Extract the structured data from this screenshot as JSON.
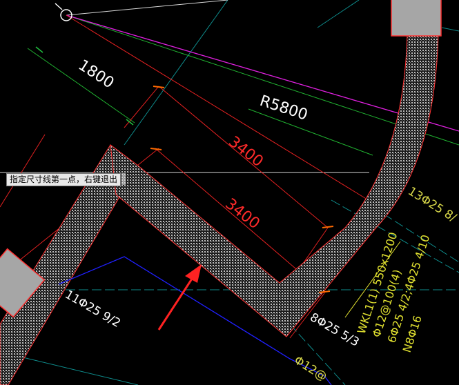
{
  "prompt": {
    "text": "指定尺寸线第一点，右键退出"
  },
  "drawing": {
    "dimensions": [
      {
        "label": "1800",
        "color": "#ffffff"
      },
      {
        "label": "R5800",
        "color": "#ffffff"
      },
      {
        "label": "3400",
        "color": "#ff2a2a"
      },
      {
        "label": "3400",
        "color": "#ff2a2a"
      }
    ],
    "rebar_labels": [
      {
        "label": "13Φ25 8/",
        "color": "#d8d84a"
      },
      {
        "label": "11Φ25  9/2",
        "color": "#ffffff"
      },
      {
        "label": "8Φ25 5/3",
        "color": "#ffffff"
      },
      {
        "label": "Φ12@",
        "color": "#d8d84a"
      }
    ],
    "beam_note": {
      "line1": "WKL1(1) 550x1200",
      "line2": "Φ12@100(4)",
      "line3": "6Φ25 4/2;4Φ25 4/10",
      "line4": "N8Φ16",
      "color": "#e0e030"
    },
    "colors": {
      "background": "#000000",
      "beam_outline": "#ff3030",
      "hatch": "#9a9a9a",
      "magenta": "#e020e0",
      "green": "#20b030",
      "blue": "#1a1aff",
      "cyan": "#00b8b8",
      "dim_tick": "#ff6a00"
    },
    "icons": [
      "ucs-origin-icon",
      "red-arrow-pointer"
    ]
  }
}
